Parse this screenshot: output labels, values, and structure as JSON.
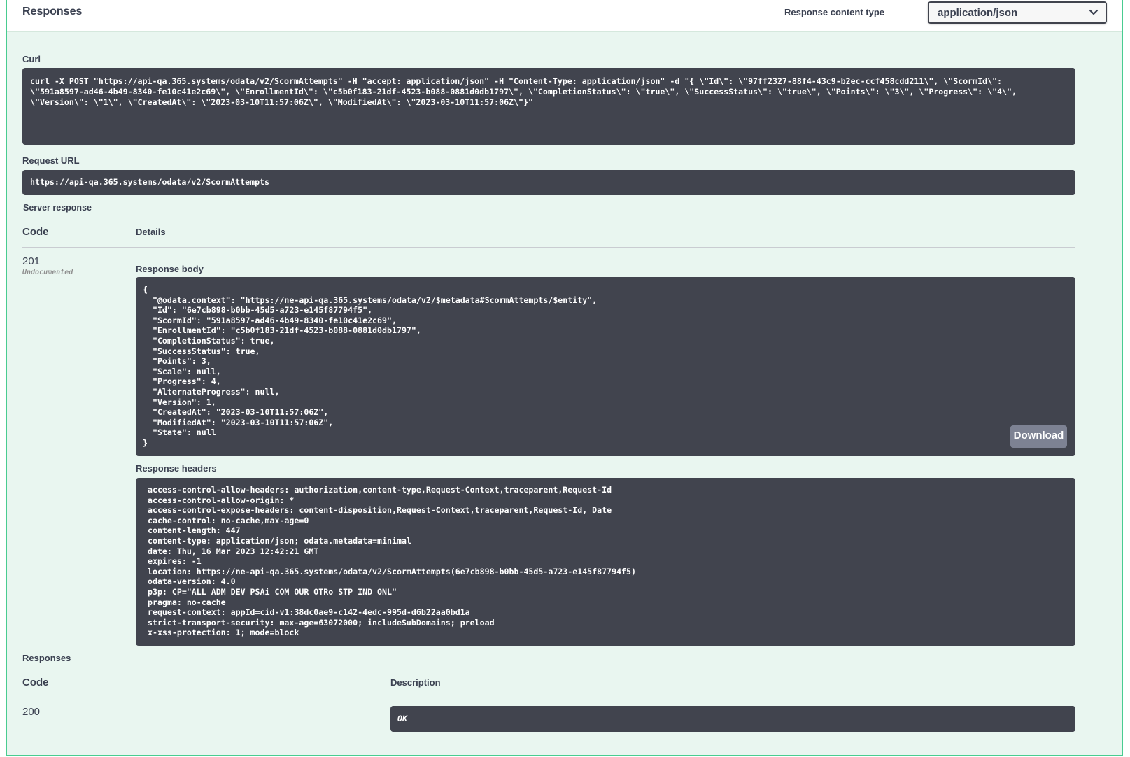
{
  "header": {
    "title": "Responses",
    "content_type_label": "Response content type",
    "content_type_value": "application/json"
  },
  "curl": {
    "label": "Curl",
    "command": "curl -X POST \"https://api-qa.365.systems/odata/v2/ScormAttempts\" -H \"accept: application/json\" -H \"Content-Type: application/json\" -d \"{ \\\"Id\\\": \\\"97ff2327-88f4-43c9-b2ec-ccf458cdd211\\\", \\\"ScormId\\\":\n\\\"591a8597-ad46-4b49-8340-fe10c41e2c69\\\", \\\"EnrollmentId\\\": \\\"c5b0f183-21df-4523-b088-0881d0db1797\\\", \\\"CompletionStatus\\\": \\\"true\\\", \\\"SuccessStatus\\\": \\\"true\\\", \\\"Points\\\": \\\"3\\\", \\\"Progress\\\": \\\"4\\\",\n\\\"Version\\\": \\\"1\\\", \\\"CreatedAt\\\": \\\"2023-03-10T11:57:06Z\\\", \\\"ModifiedAt\\\": \\\"2023-03-10T11:57:06Z\\\"}\""
  },
  "request_url": {
    "label": "Request URL",
    "value": "https://api-qa.365.systems/odata/v2/ScormAttempts"
  },
  "server_response": {
    "label": "Server response",
    "code_header": "Code",
    "details_header": "Details",
    "code": "201",
    "code_note": "Undocumented",
    "body_label": "Response body",
    "body": "{\n  \"@odata.context\": \"https://ne-api-qa.365.systems/odata/v2/$metadata#ScormAttempts/$entity\",\n  \"Id\": \"6e7cb898-b0bb-45d5-a723-e145f87794f5\",\n  \"ScormId\": \"591a8597-ad46-4b49-8340-fe10c41e2c69\",\n  \"EnrollmentId\": \"c5b0f183-21df-4523-b088-0881d0db1797\",\n  \"CompletionStatus\": true,\n  \"SuccessStatus\": true,\n  \"Points\": 3,\n  \"Scale\": null,\n  \"Progress\": 4,\n  \"AlternateProgress\": null,\n  \"Version\": 1,\n  \"CreatedAt\": \"2023-03-10T11:57:06Z\",\n  \"ModifiedAt\": \"2023-03-10T11:57:06Z\",\n  \"State\": null\n}",
    "download_label": "Download",
    "headers_label": "Response headers",
    "headers": " access-control-allow-headers: authorization,content-type,Request-Context,traceparent,Request-Id\n access-control-allow-origin: *\n access-control-expose-headers: content-disposition,Request-Context,traceparent,Request-Id, Date\n cache-control: no-cache,max-age=0\n content-length: 447\n content-type: application/json; odata.metadata=minimal\n date: Thu, 16 Mar 2023 12:42:21 GMT\n expires: -1\n location: https://ne-api-qa.365.systems/odata/v2/ScormAttempts(6e7cb898-b0bb-45d5-a723-e145f87794f5)\n odata-version: 4.0\n p3p: CP=\"ALL ADM DEV PSAi COM OUR OTRo STP IND ONL\"\n pragma: no-cache\n request-context: appId=cid-v1:38dc0ae9-c142-4edc-995d-d6b22aa0bd1a\n strict-transport-security: max-age=63072000; includeSubDomains; preload\n x-xss-protection: 1; mode=block"
  },
  "responses": {
    "label": "Responses",
    "code_header": "Code",
    "description_header": "Description",
    "rows": [
      {
        "code": "200",
        "description": "OK"
      }
    ]
  }
}
